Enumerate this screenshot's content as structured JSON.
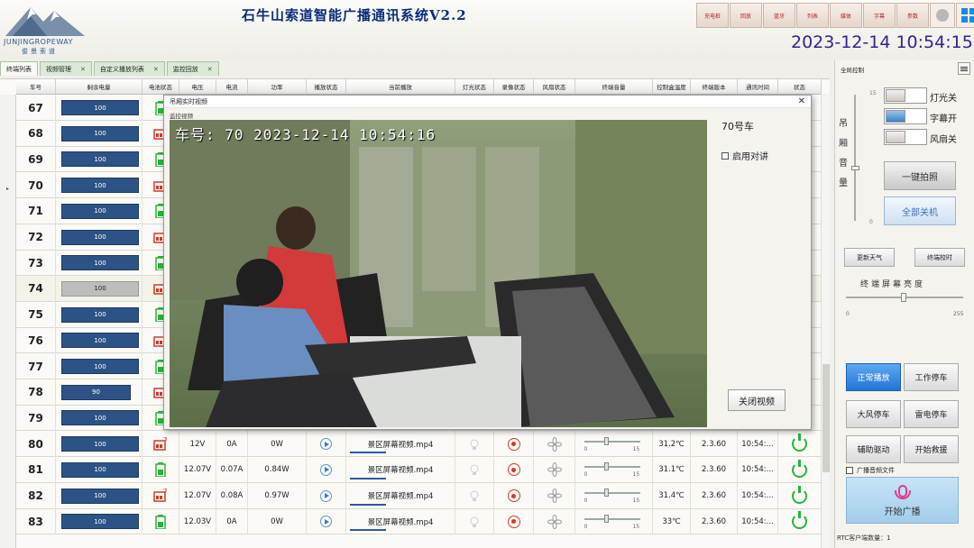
{
  "header": {
    "title": "石牛山索道智能广播通讯系统V2.2",
    "logo_text": "JUNJINGROPEWAY",
    "logo_sub": "俊景索道",
    "datetime": "2023-12-14 10:54:15",
    "top_buttons": [
      "充电桩",
      "回放",
      "蓝牙",
      "列表",
      "媒体",
      "字幕",
      "参数"
    ],
    "top_icons": [
      "circle-icon",
      "windows-icon",
      "close-icon"
    ]
  },
  "tabs": [
    {
      "label": "终端列表",
      "closable": false,
      "active": true
    },
    {
      "label": "视频管理",
      "closable": true,
      "active": false
    },
    {
      "label": "自定义播放列表",
      "closable": true,
      "active": false
    },
    {
      "label": "监控回放",
      "closable": true,
      "active": false
    }
  ],
  "table": {
    "columns": [
      "车号",
      "剩余电量",
      "电池状态",
      "电压",
      "电流",
      "功率",
      "播放状态",
      "当前播放",
      "灯光状态",
      "录像状态",
      "风扇状态",
      "终端音量",
      "控制盒温度",
      "终端版本",
      "通讯时间",
      "状态"
    ],
    "rows": [
      {
        "car": "67",
        "battery": 100,
        "voltage": "",
        "current": "",
        "power": "",
        "playing": "",
        "temp": "",
        "version": "",
        "time": ""
      },
      {
        "car": "68",
        "battery": 100,
        "voltage": "",
        "current": "",
        "power": "",
        "playing": "",
        "temp": "",
        "version": "",
        "time": ""
      },
      {
        "car": "69",
        "battery": 100,
        "voltage": "",
        "current": "",
        "power": "",
        "playing": "",
        "temp": "",
        "version": "",
        "time": ""
      },
      {
        "car": "70",
        "battery": 100,
        "voltage": "",
        "current": "",
        "power": "",
        "playing": "",
        "temp": "",
        "version": "",
        "time": ""
      },
      {
        "car": "71",
        "battery": 100,
        "voltage": "",
        "current": "",
        "power": "",
        "playing": "",
        "temp": "",
        "version": "",
        "time": ""
      },
      {
        "car": "72",
        "battery": 100,
        "voltage": "",
        "current": "",
        "power": "",
        "playing": "",
        "temp": "",
        "version": "",
        "time": ""
      },
      {
        "car": "73",
        "battery": 100,
        "voltage": "",
        "current": "",
        "power": "",
        "playing": "",
        "temp": "",
        "version": "",
        "time": ""
      },
      {
        "car": "74",
        "battery": 100,
        "voltage": "",
        "current": "",
        "power": "",
        "playing": "",
        "temp": "",
        "version": "",
        "time": "",
        "grey": true
      },
      {
        "car": "75",
        "battery": 100,
        "voltage": "",
        "current": "",
        "power": "",
        "playing": "",
        "temp": "",
        "version": "",
        "time": ""
      },
      {
        "car": "76",
        "battery": 100,
        "voltage": "",
        "current": "",
        "power": "",
        "playing": "",
        "temp": "",
        "version": "",
        "time": ""
      },
      {
        "car": "77",
        "battery": 100,
        "voltage": "",
        "current": "",
        "power": "",
        "playing": "",
        "temp": "",
        "version": "",
        "time": ""
      },
      {
        "car": "78",
        "battery": 90,
        "voltage": "",
        "current": "",
        "power": "",
        "playing": "",
        "temp": "",
        "version": "",
        "time": ""
      },
      {
        "car": "79",
        "battery": 100,
        "voltage": "",
        "current": "",
        "power": "",
        "playing": "",
        "temp": "",
        "version": "",
        "time": ""
      },
      {
        "car": "80",
        "battery": 100,
        "voltage": "12V",
        "current": "0A",
        "power": "0W",
        "playing": "景区屏幕视频.mp4",
        "temp": "31.2℃",
        "version": "2.3.60",
        "time": "10:54:..."
      },
      {
        "car": "81",
        "battery": 100,
        "voltage": "12.07V",
        "current": "0.07A",
        "power": "0.84W",
        "playing": "景区屏幕视频.mp4",
        "temp": "31.1℃",
        "version": "2.3.60",
        "time": "10:54:..."
      },
      {
        "car": "82",
        "battery": 100,
        "voltage": "12.07V",
        "current": "0.08A",
        "power": "0.97W",
        "playing": "景区屏幕视频.mp4",
        "temp": "31.4℃",
        "version": "2.3.60",
        "time": "10:54:..."
      },
      {
        "car": "83",
        "battery": 100,
        "voltage": "12.03V",
        "current": "0A",
        "power": "0W",
        "playing": "景区屏幕视频.mp4",
        "temp": "33℃",
        "version": "2.3.60",
        "time": "10:54:..."
      }
    ],
    "volume_min": "0",
    "volume_max": "15"
  },
  "dialog": {
    "title": "吊厢实时视频",
    "subtitle": "监控视频",
    "osd_text": "车号: 70   2023-12-14 10:54:16",
    "car_label": "70号车",
    "talk_label": "启用对讲",
    "close_button": "关闭视频"
  },
  "panel": {
    "title": "全局控制",
    "volume_label": [
      "吊",
      "厢",
      "音",
      "量"
    ],
    "volume_max": "15",
    "volume_min": "0",
    "toggles": [
      {
        "label": "灯光关",
        "on": false
      },
      {
        "label": "字幕开",
        "on": true
      },
      {
        "label": "风扇关",
        "on": false
      }
    ],
    "photo_button": "一键拍照",
    "shutdown_button": "全部关机",
    "weather_button": "更新天气",
    "terminal_button": "终端校时",
    "brightness_title": "终端屏幕亮度",
    "brightness_min": "0",
    "brightness_max": "255",
    "control_buttons": [
      "正常播放",
      "工作停车",
      "大风停车",
      "雷电停车",
      "辅助驱动",
      "开始救援"
    ],
    "audio_file_label": "广播音频文件",
    "broadcast_button": "开始广播",
    "rtc_status": "RTC客户端数量：1"
  }
}
